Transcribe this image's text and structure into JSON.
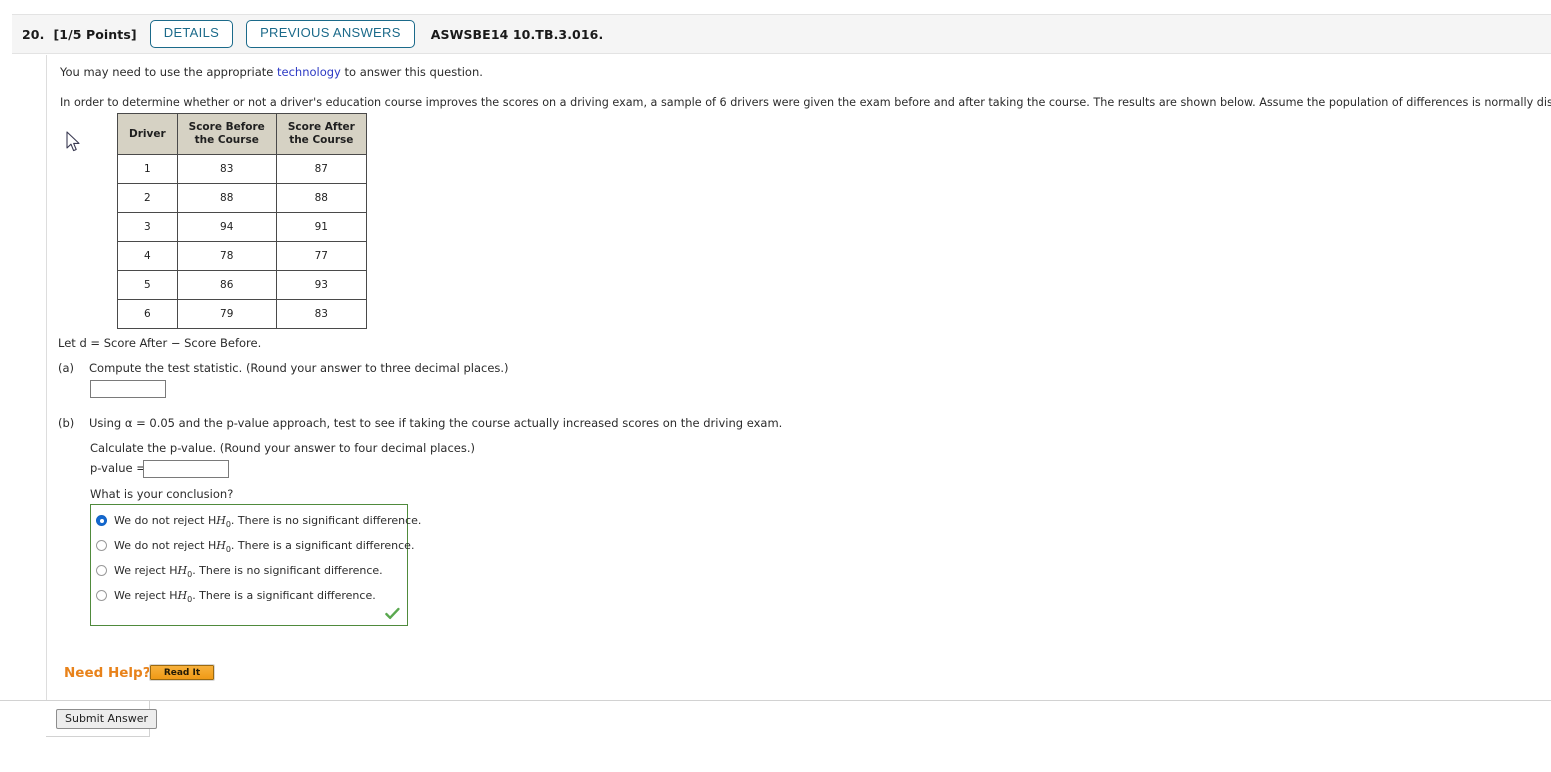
{
  "header": {
    "number": "20.",
    "points": "[1/5 Points]",
    "details_label": "DETAILS",
    "previous_answers_label": "PREVIOUS ANSWERS",
    "code": "ASWSBE14 10.TB.3.016.",
    "accent_color": "#1b6a8a",
    "background": "#f5f5f5"
  },
  "body": {
    "note_prefix": "You may need to use the appropriate ",
    "note_link": "technology",
    "note_suffix": " to answer this question.",
    "prompt": "In order to determine whether or not a driver's education course improves the scores on a driving exam, a sample of 6 drivers were given the exam before and after taking the course. The results are shown below. Assume the population of differences is normally distributed.",
    "let_d": "Let d = Score After − Score Before."
  },
  "table": {
    "headers": [
      "Driver",
      "Score Before the Course",
      "Score After the Course"
    ],
    "header_lines": [
      [
        "Driver"
      ],
      [
        "Score Before",
        "the Course"
      ],
      [
        "Score After",
        "the Course"
      ]
    ],
    "before_color": "#d42a13",
    "header_background": "#d6d2c4",
    "rows": [
      {
        "driver": "1",
        "before": "83",
        "after": "87"
      },
      {
        "driver": "2",
        "before": "88",
        "after": "88"
      },
      {
        "driver": "3",
        "before": "94",
        "after": "91"
      },
      {
        "driver": "4",
        "before": "78",
        "after": "77"
      },
      {
        "driver": "5",
        "before": "86",
        "after": "93"
      },
      {
        "driver": "6",
        "before": "79",
        "after": "83"
      }
    ]
  },
  "part_a": {
    "label": "(a)",
    "text": "Compute the test statistic. (Round your answer to three decimal places.)",
    "input_value": "",
    "input_placeholder": ""
  },
  "part_b": {
    "label": "(b)",
    "text": "Using α = 0.05 and the p-value approach, test to see if taking the course actually increased scores on the driving exam.",
    "calc_text": "Calculate the p-value. (Round your answer to four decimal places.)",
    "pvalue_label": "p-value =",
    "pvalue_input_value": "",
    "conclusion_question": "What is your conclusion?",
    "options": [
      {
        "text_pre": "We do not reject H",
        "sub": "0",
        "text_post": ". There is no significant difference.",
        "selected": true
      },
      {
        "text_pre": "We do not reject H",
        "sub": "0",
        "text_post": ". There is a significant difference.",
        "selected": false
      },
      {
        "text_pre": "We reject H",
        "sub": "0",
        "text_post": ". There is no significant difference.",
        "selected": false
      },
      {
        "text_pre": "We reject H",
        "sub": "0",
        "text_post": ". There is a significant difference.",
        "selected": false
      }
    ],
    "correct_mark": "✔",
    "border_color": "#4f8a3c",
    "check_color": "#5aa84f"
  },
  "help": {
    "label": "Need Help?",
    "read_it_label": "Read It",
    "color": "#e8821a"
  },
  "footer": {
    "submit_label": "Submit Answer"
  }
}
